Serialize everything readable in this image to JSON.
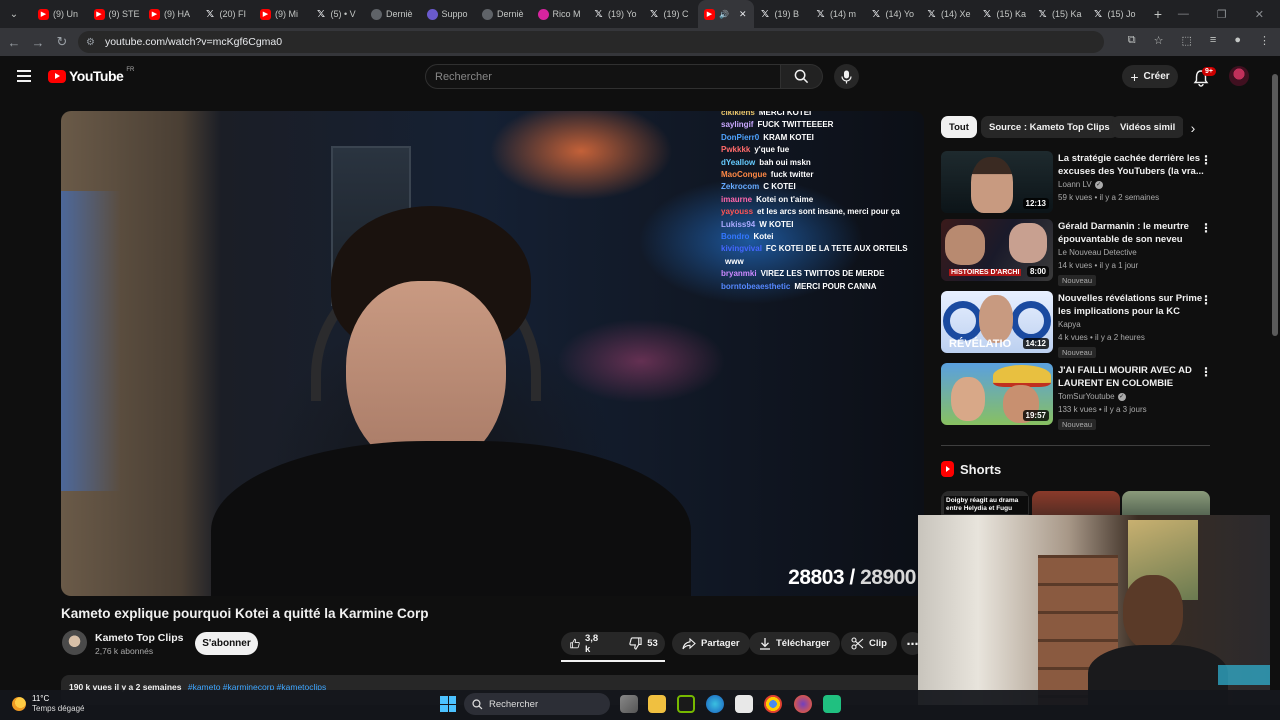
{
  "browser": {
    "tabs": [
      {
        "title": "(9) Un",
        "icon": "youtube-icon"
      },
      {
        "title": "(9) STE",
        "icon": "youtube-icon"
      },
      {
        "title": "(9) HA",
        "icon": "youtube-icon"
      },
      {
        "title": "(20) FI",
        "icon": "x-icon"
      },
      {
        "title": "(9) Mi",
        "icon": "youtube-icon"
      },
      {
        "title": "(5) • V",
        "icon": "x-icon"
      },
      {
        "title": "Derniè",
        "icon": "news-icon"
      },
      {
        "title": "Suppo",
        "icon": "support-icon"
      },
      {
        "title": "Derniè",
        "icon": "news-icon"
      },
      {
        "title": "Rico M",
        "icon": "instagram-icon"
      },
      {
        "title": "(19) Yo",
        "icon": "x-icon"
      },
      {
        "title": "(19) C",
        "icon": "x-icon"
      },
      {
        "title": "",
        "icon": "youtube-icon",
        "active": true
      },
      {
        "title": "(19) B",
        "icon": "x-icon"
      },
      {
        "title": "(14) m",
        "icon": "x-icon"
      },
      {
        "title": "(14) Yo",
        "icon": "x-icon"
      },
      {
        "title": "(14) Xe",
        "icon": "x-icon"
      },
      {
        "title": "(15) Ka",
        "icon": "x-icon"
      },
      {
        "title": "(15) Ka",
        "icon": "x-icon"
      },
      {
        "title": "(15) Jo",
        "icon": "x-icon"
      }
    ],
    "url": "youtube.com/watch?v=mcKgf6Cgma0"
  },
  "header": {
    "logo_text": "YouTube",
    "region": "FR",
    "search_placeholder": "Rechercher",
    "create_label": "Créer",
    "notif_count": "9+"
  },
  "video": {
    "title": "Kameto explique pourquoi Kotei a quitté la Karmine Corp",
    "channel": "Kameto Top Clips",
    "subscribers": "2,76 k abonnés",
    "subscribe_label": "S'abonner",
    "likes": "3,8 k",
    "dislikes": "53",
    "share_label": "Partager",
    "download_label": "Télécharger",
    "clip_label": "Clip",
    "description_stats": "190 k vues  il y a 2 semaines",
    "description_tags": "#kameto #karminecorp #kametoclips",
    "overlay_count": "28803",
    "overlay_total": "28900",
    "chat": [
      {
        "user": "cikikiens",
        "msg": "MERCI KOTEI",
        "color": "#e8c46a"
      },
      {
        "user": "saylingif",
        "msg": "FUCK TWITTEEEER",
        "color": "#c9a8ff"
      },
      {
        "user": "DonPierr0",
        "msg": "KRAM     KOTEI",
        "color": "#4fa3ff"
      },
      {
        "user": "Pwkkkk",
        "msg": "y'que fue",
        "color": "#ff6a6a"
      },
      {
        "user": "dYeallow",
        "msg": "bah oui mskn",
        "color": "#66ccff"
      },
      {
        "user": "MaoCongue",
        "msg": "fuck twitter",
        "color": "#ff8844"
      },
      {
        "user": "Zekrocom",
        "msg": "C KOTEI",
        "color": "#66aaff"
      },
      {
        "user": "imaurne",
        "msg": "Kotei on t'aime",
        "color": "#ff66aa"
      },
      {
        "user": "yayouss",
        "msg": "et les arcs sont insane, merci pour ça",
        "color": "#ff5555"
      },
      {
        "user": "Lukiss94",
        "msg": "W KOTEI",
        "color": "#aaaaff"
      },
      {
        "user": "Bondro",
        "msg": "Kotei",
        "color": "#3377ff"
      },
      {
        "user": "kivingvival",
        "msg": "FC KOTEI DE LA TETE AUX ORTEILS",
        "color": "#4466ff"
      },
      {
        "user": "",
        "msg": "www",
        "color": "#ffffff"
      },
      {
        "user": "bryanmki",
        "msg": "VIREZ LES TWITTOS DE MERDE",
        "color": "#cc88ff"
      },
      {
        "user": "borntobeaesthetic",
        "msg": "MERCI POUR CANNA",
        "color": "#5588ff"
      }
    ]
  },
  "chips": [
    "Tout",
    "Source : Kameto Top Clips",
    "Vidéos simil"
  ],
  "recommendations": [
    {
      "title": "La stratégie cachée derrière les excuses des YouTubers (la vra...",
      "channel": "Loann LV",
      "verified": true,
      "meta": "59 k vues • il y a 2 semaines",
      "duration": "12:13",
      "badge": ""
    },
    {
      "title": "Gérald Darmanin : le meurtre épouvantable de son neveu",
      "channel": "Le Nouveau Detective",
      "verified": false,
      "meta": "14 k vues • il y a 1 jour",
      "duration": "8:00",
      "badge": "Nouveau",
      "thumb_caption": "HISTOIRES D'ARCHI"
    },
    {
      "title": "Nouvelles révélations sur Prime : les implications pour la KC",
      "channel": "Kapya",
      "verified": false,
      "meta": "4 k vues • il y a 2 heures",
      "duration": "14:12",
      "badge": "Nouveau",
      "thumb_caption": "RÉVÉLATIO"
    },
    {
      "title": "J'AI FAILLI MOURIR AVEC AD LAURENT EN COLOMBIE",
      "channel": "TomSurYoutube",
      "verified": true,
      "meta": "133 k vues • il y a 3 jours",
      "duration": "19:57",
      "badge": "Nouveau"
    }
  ],
  "shorts": {
    "heading": "Shorts",
    "items": [
      {
        "caption": "Doigby réagit au drama entre Helydia et Fugu"
      }
    ]
  },
  "taskbar": {
    "temperature": "11°C",
    "weather": "Temps dégagé",
    "search_placeholder": "Rechercher"
  },
  "colors": {
    "accent_red": "#ff0000",
    "background": "#0f0f0f",
    "pill": "#272727",
    "link_blue": "#3ea6ff"
  }
}
